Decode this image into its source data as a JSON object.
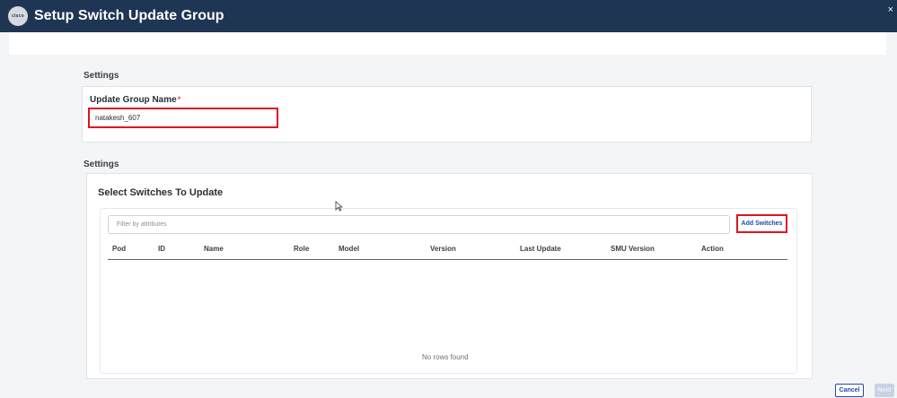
{
  "header": {
    "logo_text": "cisco",
    "title": "Setup Switch Update Group",
    "close_label": "×"
  },
  "settings_section": {
    "label": "Settings"
  },
  "update_group": {
    "field_label": "Update Group Name",
    "required_mark": "*",
    "value": "natakesh_607"
  },
  "switches_section": {
    "label": "Settings",
    "card_title": "Select Switches To Update",
    "filter_placeholder": "Filter by attributes",
    "add_button": "Add Switches",
    "columns": [
      "Pod",
      "ID",
      "Name",
      "Role",
      "Model",
      "Version",
      "Last Update",
      "SMU Version",
      "Action"
    ],
    "empty_text": "No rows found"
  },
  "footer": {
    "cancel_label": "Cancel",
    "next_label": "Next"
  },
  "colors": {
    "header_bg": "#1f3554",
    "highlight": "#e0141e",
    "link_blue": "#1f4aa8"
  }
}
